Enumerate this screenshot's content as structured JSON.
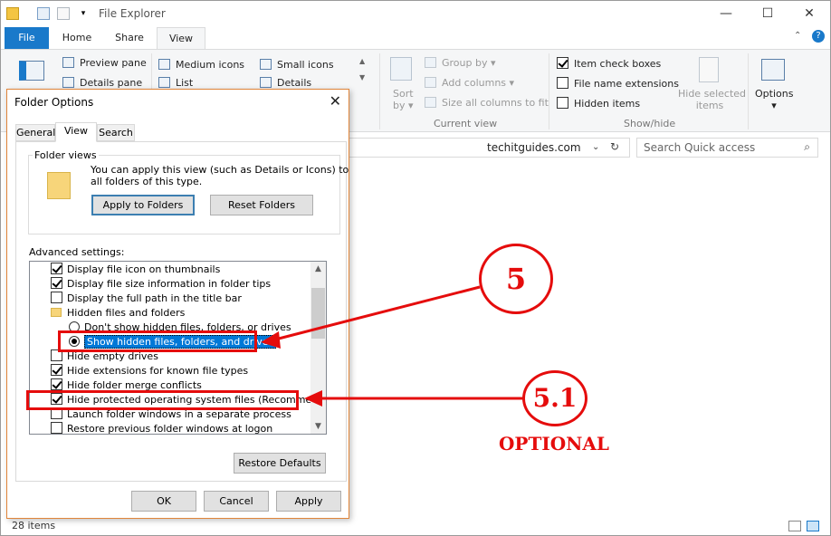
{
  "window": {
    "title": "File Explorer",
    "minimize": "—",
    "maximize": "☐",
    "close": "✕"
  },
  "tabs": {
    "file": "File",
    "home": "Home",
    "share": "Share",
    "view": "View"
  },
  "ribbon": {
    "preview_pane": "Preview pane",
    "details_pane": "Details pane",
    "medium_icons": "Medium icons",
    "small_icons": "Small icons",
    "list": "List",
    "details": "Details",
    "sort_by": "Sort",
    "sort_by2": "by",
    "group_by": "Group by",
    "add_columns": "Add columns",
    "size_columns": "Size all columns to fit",
    "current_view": "Current view",
    "item_check_boxes": "Item check boxes",
    "file_name_extensions": "File name extensions",
    "hidden_items": "Hidden items",
    "hide_selected": "Hide selected",
    "hide_selected2": "items",
    "show_hide": "Show/hide",
    "options": "Options"
  },
  "address": {
    "path": "techitguides.com",
    "search_placeholder": "Search Quick access"
  },
  "status": {
    "items": "28 items"
  },
  "dialog": {
    "title": "Folder Options",
    "tabs": [
      "General",
      "View",
      "Search"
    ],
    "folder_views_label": "Folder views",
    "folder_views_text1": "You can apply this view (such as Details or Icons) to",
    "folder_views_text2": "all folders of this type.",
    "apply_to_folders": "Apply to Folders",
    "reset_folders": "Reset Folders",
    "advanced_label": "Advanced settings:",
    "settings": [
      "Display file icon on thumbnails",
      "Display file size information in folder tips",
      "Display the full path in the title bar",
      "Hidden files and folders",
      "Don't show hidden files, folders, or drives",
      "Show hidden files, folders, and drives",
      "Hide empty drives",
      "Hide extensions for known file types",
      "Hide folder merge conflicts",
      "Hide protected operating system files (Recommended)",
      "Launch folder windows in a separate process",
      "Restore previous folder windows at logon"
    ],
    "restore_defaults": "Restore Defaults",
    "ok": "OK",
    "cancel": "Cancel",
    "apply": "Apply"
  },
  "annotations": {
    "step5": "5",
    "step51": "5.1",
    "optional": "OPTIONAL",
    "color": "#e50c0c"
  }
}
